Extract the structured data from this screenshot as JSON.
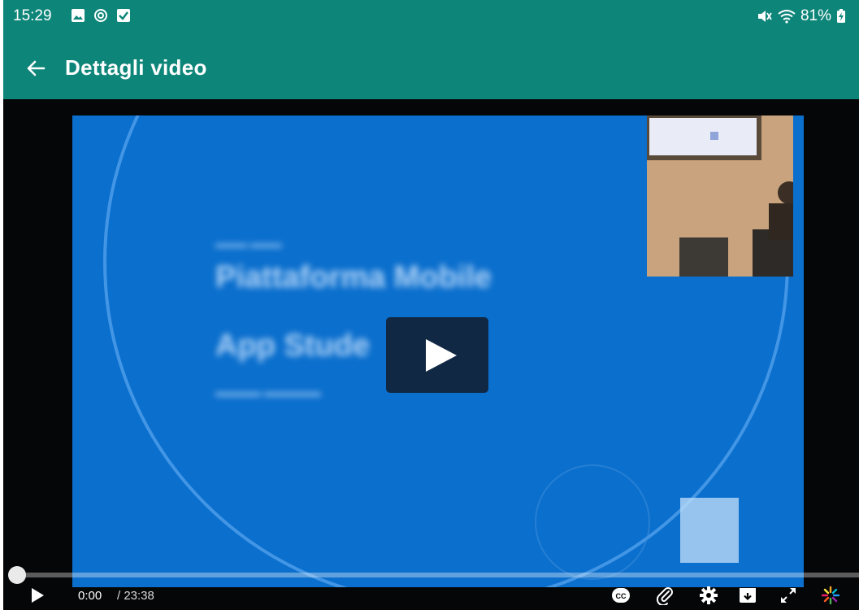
{
  "status_bar": {
    "time": "15:29",
    "battery": "81%",
    "icons_left": [
      "image-icon",
      "sync-icon",
      "checkbox-icon"
    ],
    "icons_right": [
      "mute-icon",
      "wifi-icon",
      "battery-charging-icon"
    ]
  },
  "app_bar": {
    "title": "Dettagli video",
    "background_color": "#0d8579"
  },
  "video": {
    "slide_line1": "Piattaforma Mobile",
    "slide_line2": "App Stude",
    "progress": 0.0
  },
  "controls": {
    "current_time": "0:00",
    "duration": "/ 23:38",
    "buttons": [
      "closed-captions-icon",
      "attachment-icon",
      "settings-icon",
      "download-icon",
      "fullscreen-icon",
      "kaltura-logo-icon"
    ]
  }
}
